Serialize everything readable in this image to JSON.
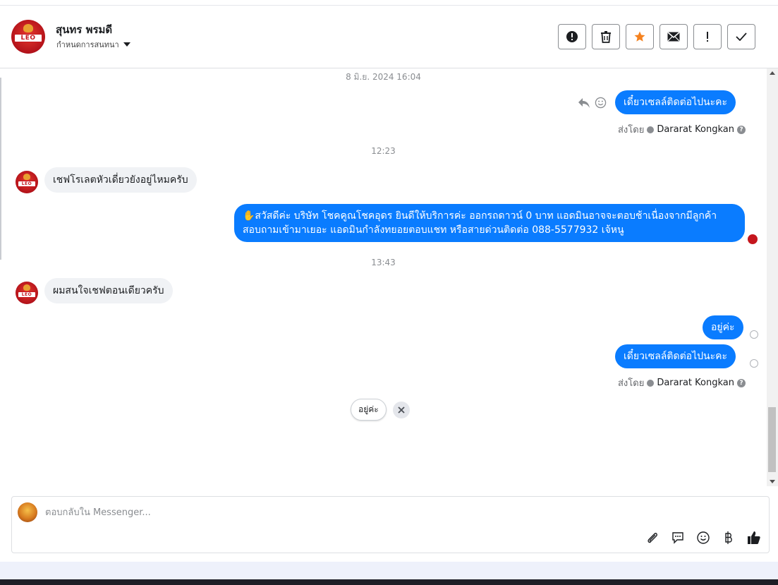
{
  "header": {
    "contact_name": "สุนทร พรมดี",
    "assign_label": "กำหนดการสนทนา",
    "avatar_text": "LEO"
  },
  "toolbar": [
    {
      "name": "report-spam-button",
      "icon": "alert-circle-icon"
    },
    {
      "name": "delete-button",
      "icon": "trash-icon"
    },
    {
      "name": "star-button",
      "icon": "star-icon"
    },
    {
      "name": "mark-unread-button",
      "icon": "envelope-icon"
    },
    {
      "name": "follow-up-button",
      "icon": "exclamation-icon"
    },
    {
      "name": "mark-done-button",
      "icon": "check-icon"
    }
  ],
  "colors": {
    "outgoing_bubble": "#0a7cff",
    "incoming_bubble": "#f0f2f5",
    "star": "#f5821f",
    "brand_red": "#c5161d"
  },
  "messages": {
    "ts1": "8 มิ.ย. 2024 16:04",
    "m1": "เดี๋ยวเซลล์ติดต่อไปนะคะ",
    "sent_by_label": "ส่งโดย",
    "agent_name": "Dararat Kongkan",
    "ts2": "12:23",
    "m2": "เชฟโรเลตหัวเดี่ยวยังอยู่ไหมครับ",
    "m3": "✋สวัสดีค่ะ บริษัท โชคคูณโชคอุดร ยินดีให้บริการค่ะ ออกรถดาวน์ 0 บาท แอดมินอาจจะตอบช้าเนื่องจากมีลูกค้าสอบถามเข้ามาเยอะ แอดมินกำลังทยอยตอบแชท หรือสายด่วนติดต่อ 088-5577932 เจ้หนู",
    "ts3": "13:43",
    "m4": "ผมสนใจเชฟตอนเดียวครับ",
    "m5": "อยู่ค่ะ",
    "m6": "เดี๋ยวเซลล์ติดต่อไปนะคะ",
    "sent_by_label_2": "ส่งโดย",
    "agent_name_2": "Dararat Kongkan"
  },
  "quick_reply": {
    "label": "อยู่ค่ะ"
  },
  "composer": {
    "placeholder": "ตอบกลับใน Messenger..."
  },
  "composer_tools": [
    "paperclip-icon",
    "speech-bubble-icon",
    "emoji-icon",
    "baht-icon",
    "thumbs-up-icon"
  ]
}
